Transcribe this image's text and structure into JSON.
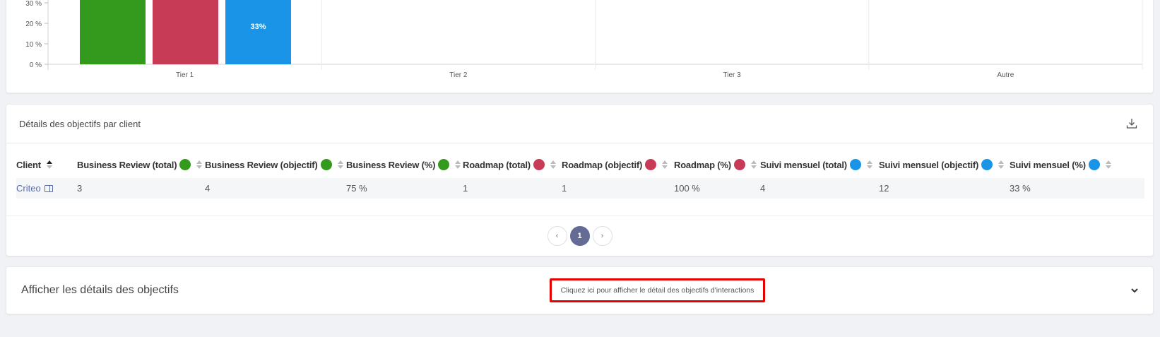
{
  "chart": {
    "y_ticks": [
      "0 %",
      "10 %",
      "20 %",
      "30 %"
    ],
    "categories": [
      "Tier 1",
      "Tier 2",
      "Tier 3",
      "Autre"
    ],
    "bar_label": "33%"
  },
  "chart_data": {
    "type": "bar",
    "categories": [
      "Tier 1",
      "Tier 2",
      "Tier 3",
      "Autre"
    ],
    "series": [
      {
        "color": "#339a1e",
        "values": [
          75,
          0,
          0,
          0
        ]
      },
      {
        "color": "#c73b56",
        "values": [
          100,
          0,
          0,
          0
        ]
      },
      {
        "color": "#1a94e6",
        "values": [
          33,
          0,
          0,
          0
        ]
      }
    ],
    "ylim": [
      0,
      30
    ],
    "yticks": [
      0,
      10,
      20,
      30
    ],
    "data_labels": [
      {
        "series": 2,
        "category": 0,
        "text": "33%"
      }
    ],
    "grid": "vertical category separators"
  },
  "colors": {
    "business_review": "#339a1e",
    "roadmap": "#c73b56",
    "suivi_mensuel": "#1a94e6",
    "highlight_border": "#e60000",
    "pager_active": "#646b95"
  },
  "table_card": {
    "title": "Détails des objectifs par client",
    "download_icon": "download-icon",
    "columns": [
      {
        "label": "Client",
        "dot": null,
        "sort": "asc"
      },
      {
        "label": "Business Review (total)",
        "dot": "business_review"
      },
      {
        "label": "Business Review (objectif)",
        "dot": "business_review"
      },
      {
        "label": "Business Review (%)",
        "dot": "business_review"
      },
      {
        "label": "Roadmap (total)",
        "dot": "roadmap"
      },
      {
        "label": "Roadmap (objectif)",
        "dot": "roadmap"
      },
      {
        "label": "Roadmap (%)",
        "dot": "roadmap"
      },
      {
        "label": "Suivi mensuel (total)",
        "dot": "suivi_mensuel"
      },
      {
        "label": "Suivi mensuel (objectif)",
        "dot": "suivi_mensuel"
      },
      {
        "label": "Suivi mensuel (%)",
        "dot": "suivi_mensuel"
      }
    ],
    "rows": [
      [
        "Criteo",
        "3",
        "4",
        "75 %",
        "1",
        "1",
        "100 %",
        "4",
        "12",
        "33 %"
      ]
    ],
    "pagination": {
      "prev": "‹",
      "current": "1",
      "next": "›"
    }
  },
  "details_card": {
    "title": "Afficher les détails des objectifs",
    "hint": "Cliquez ici pour afficher le détail des objectifs d'interactions",
    "toggle_icon": "chevron-down-icon"
  }
}
